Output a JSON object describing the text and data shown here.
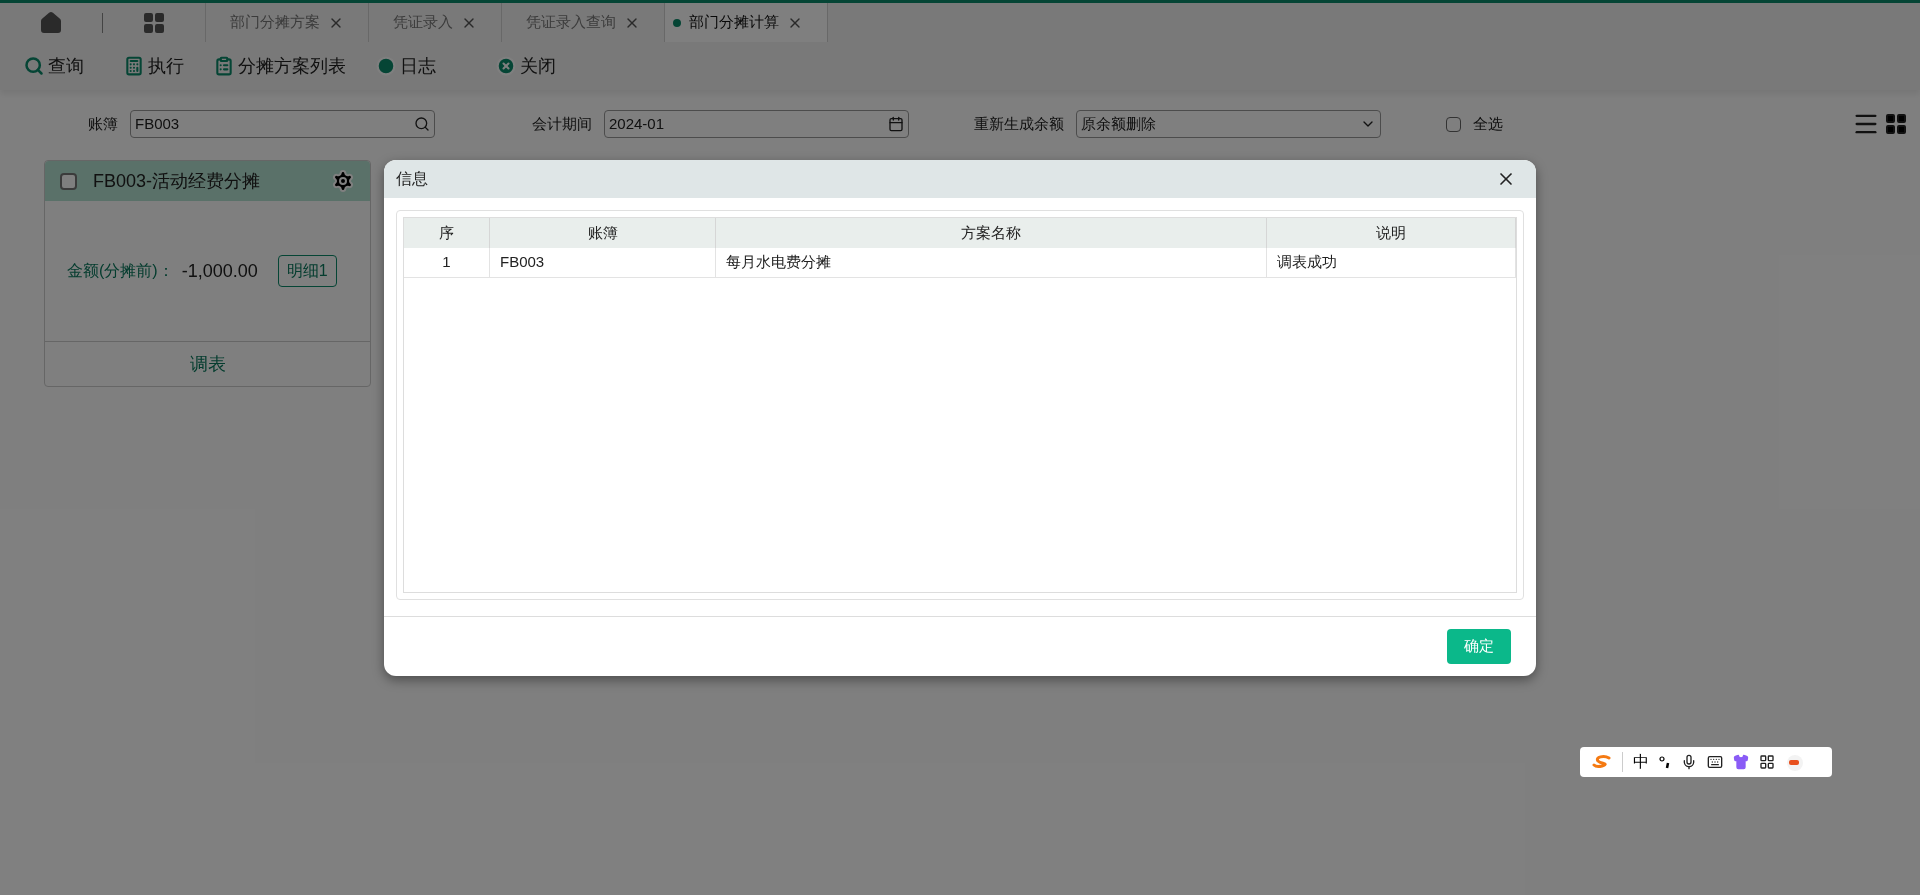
{
  "tabs": [
    {
      "label": "部门分摊方案",
      "selected": false
    },
    {
      "label": "凭证录入",
      "selected": false
    },
    {
      "label": "凭证录入查询",
      "selected": false
    },
    {
      "label": "部门分摊计算",
      "selected": true
    }
  ],
  "toolbar": [
    {
      "kind": "search",
      "label": "查询"
    },
    {
      "kind": "execute",
      "label": "执行"
    },
    {
      "kind": "list",
      "label": "分摊方案列表"
    },
    {
      "kind": "log",
      "label": "日志"
    },
    {
      "kind": "close",
      "label": "关闭"
    }
  ],
  "filters": {
    "ledger": {
      "label": "账簿",
      "value": "FB003"
    },
    "period": {
      "label": "会计期间",
      "value": "2024-01"
    },
    "regenerate": {
      "label": "重新生成余额",
      "value": "原余额删除"
    },
    "select_all": {
      "label": "全选",
      "checked": false
    }
  },
  "cards": [
    {
      "title": "FB003-活动经费分摊",
      "checked": false,
      "amount_label": "金额(分摊前)：",
      "amount": "-1,000.00",
      "detail_button": "明细1",
      "footer_link": "调表"
    }
  ],
  "dialog": {
    "title": "信息",
    "table": {
      "columns": [
        "序",
        "账簿",
        "方案名称",
        "说明"
      ],
      "rows": [
        [
          "1",
          "FB003",
          "每月水电费分摊",
          "调表成功"
        ]
      ]
    },
    "ok_button": "确定"
  },
  "ime_toolbar": {
    "mode": "中"
  }
}
